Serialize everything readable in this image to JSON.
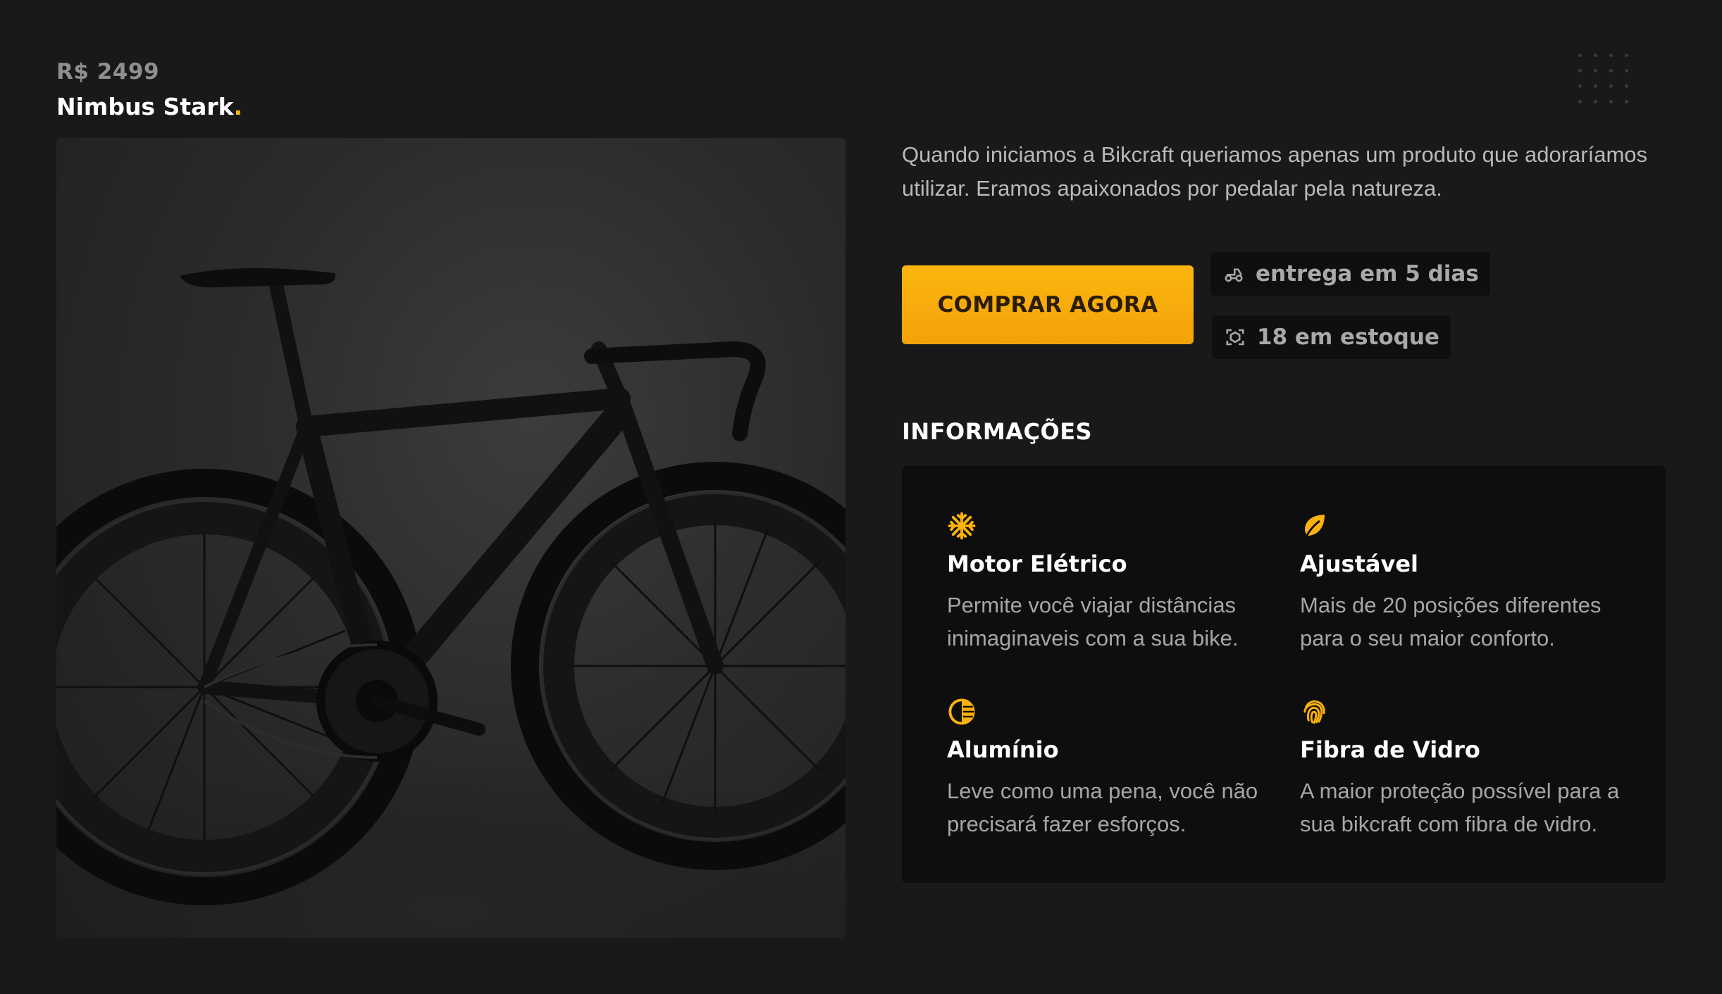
{
  "product": {
    "price": "R$ 2499",
    "name": "Nimbus Stark",
    "name_dot": ".",
    "description": "Quando iniciamos a Bikcraft queriamos apenas um produto que adoraríamos utilizar. Eramos apaixonados por pedalar pela natureza.",
    "image_alt": "bicicleta preta"
  },
  "actions": {
    "buy_label": "COMPRAR AGORA"
  },
  "chips": {
    "delivery": {
      "icon": "delivery-icon",
      "label": "entrega em 5 dias"
    },
    "stock": {
      "icon": "stock-icon",
      "label": "18 em estoque"
    }
  },
  "info": {
    "title": "INFORMAÇÕES",
    "features": [
      {
        "icon": "snowflake-icon",
        "title": "Motor Elétrico",
        "text": "Permite você viajar distâncias inimaginaveis com a sua bike."
      },
      {
        "icon": "leaf-icon",
        "title": "Ajustável",
        "text": "Mais de 20 posições diferentes para o seu maior conforto."
      },
      {
        "icon": "half-circle-icon",
        "title": "Alumínio",
        "text": "Leve como uma pena, você não precisará fazer esforços."
      },
      {
        "icon": "fingerprint-icon",
        "title": "Fibra de Vidro",
        "text": "A maior proteção possível para a sua bikcraft com fibra de vidro."
      }
    ]
  },
  "colors": {
    "background": "#191919",
    "accent": "#fbb10e",
    "panel": "#0e0e0e",
    "text_muted": "#a6a6a6"
  }
}
